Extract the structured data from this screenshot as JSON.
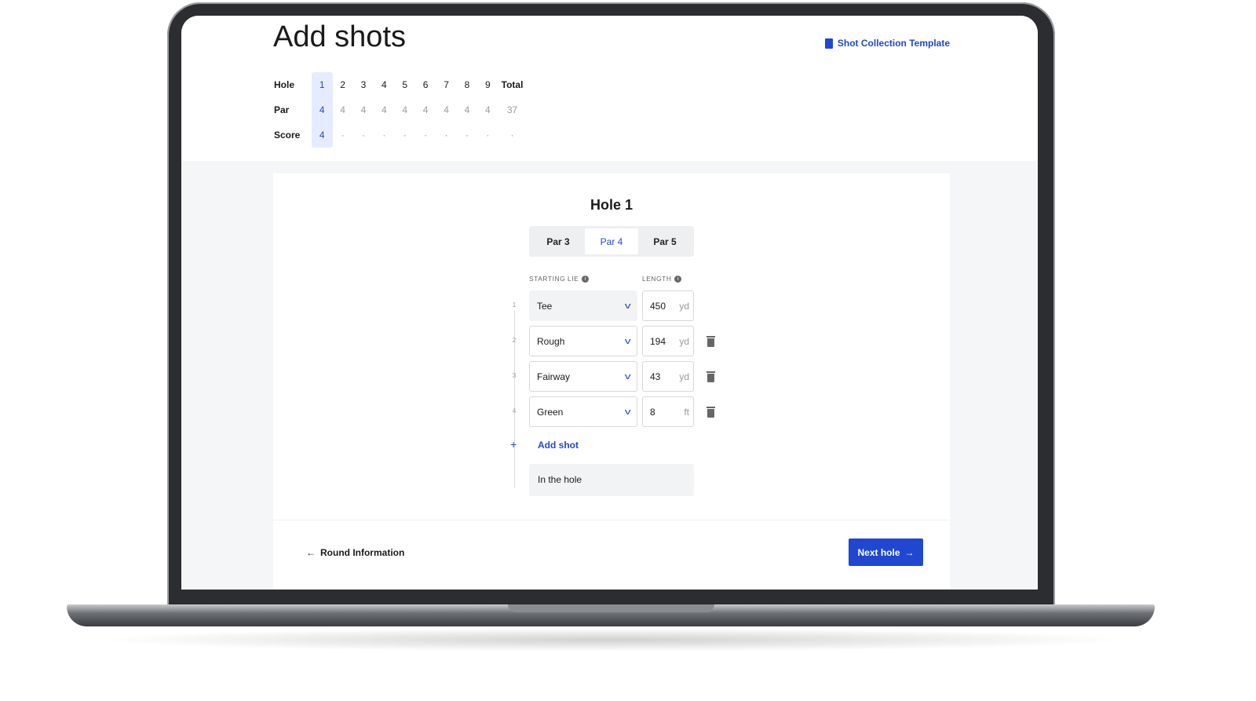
{
  "page": {
    "title": "Add shots",
    "template_link": "Shot Collection Template"
  },
  "scorecard": {
    "labels": {
      "hole": "Hole",
      "par": "Par",
      "score": "Score"
    },
    "holes": [
      "1",
      "2",
      "3",
      "4",
      "5",
      "6",
      "7",
      "8",
      "9"
    ],
    "total_label": "Total",
    "pars": [
      "4",
      "4",
      "4",
      "4",
      "4",
      "4",
      "4",
      "4",
      "4"
    ],
    "par_total": "37",
    "scores": [
      "4",
      "·",
      "·",
      "·",
      "·",
      "·",
      "·",
      "·",
      "·"
    ],
    "score_total": "·"
  },
  "hole": {
    "title": "Hole 1",
    "par_options": [
      "Par 3",
      "Par 4",
      "Par 5"
    ],
    "selected_par": "Par 4",
    "starting_lie_label": "STARTING LIE",
    "length_label": "LENGTH",
    "shots": [
      {
        "n": "1",
        "lie": "Tee",
        "length": "450",
        "unit": "yd"
      },
      {
        "n": "2",
        "lie": "Rough",
        "length": "194",
        "unit": "yd"
      },
      {
        "n": "3",
        "lie": "Fairway",
        "length": "43",
        "unit": "yd"
      },
      {
        "n": "4",
        "lie": "Green",
        "length": "8",
        "unit": "ft"
      }
    ],
    "add_shot": "Add shot",
    "in_the_hole": "In the hole"
  },
  "footer": {
    "back": "Round Information",
    "next": "Next hole"
  }
}
